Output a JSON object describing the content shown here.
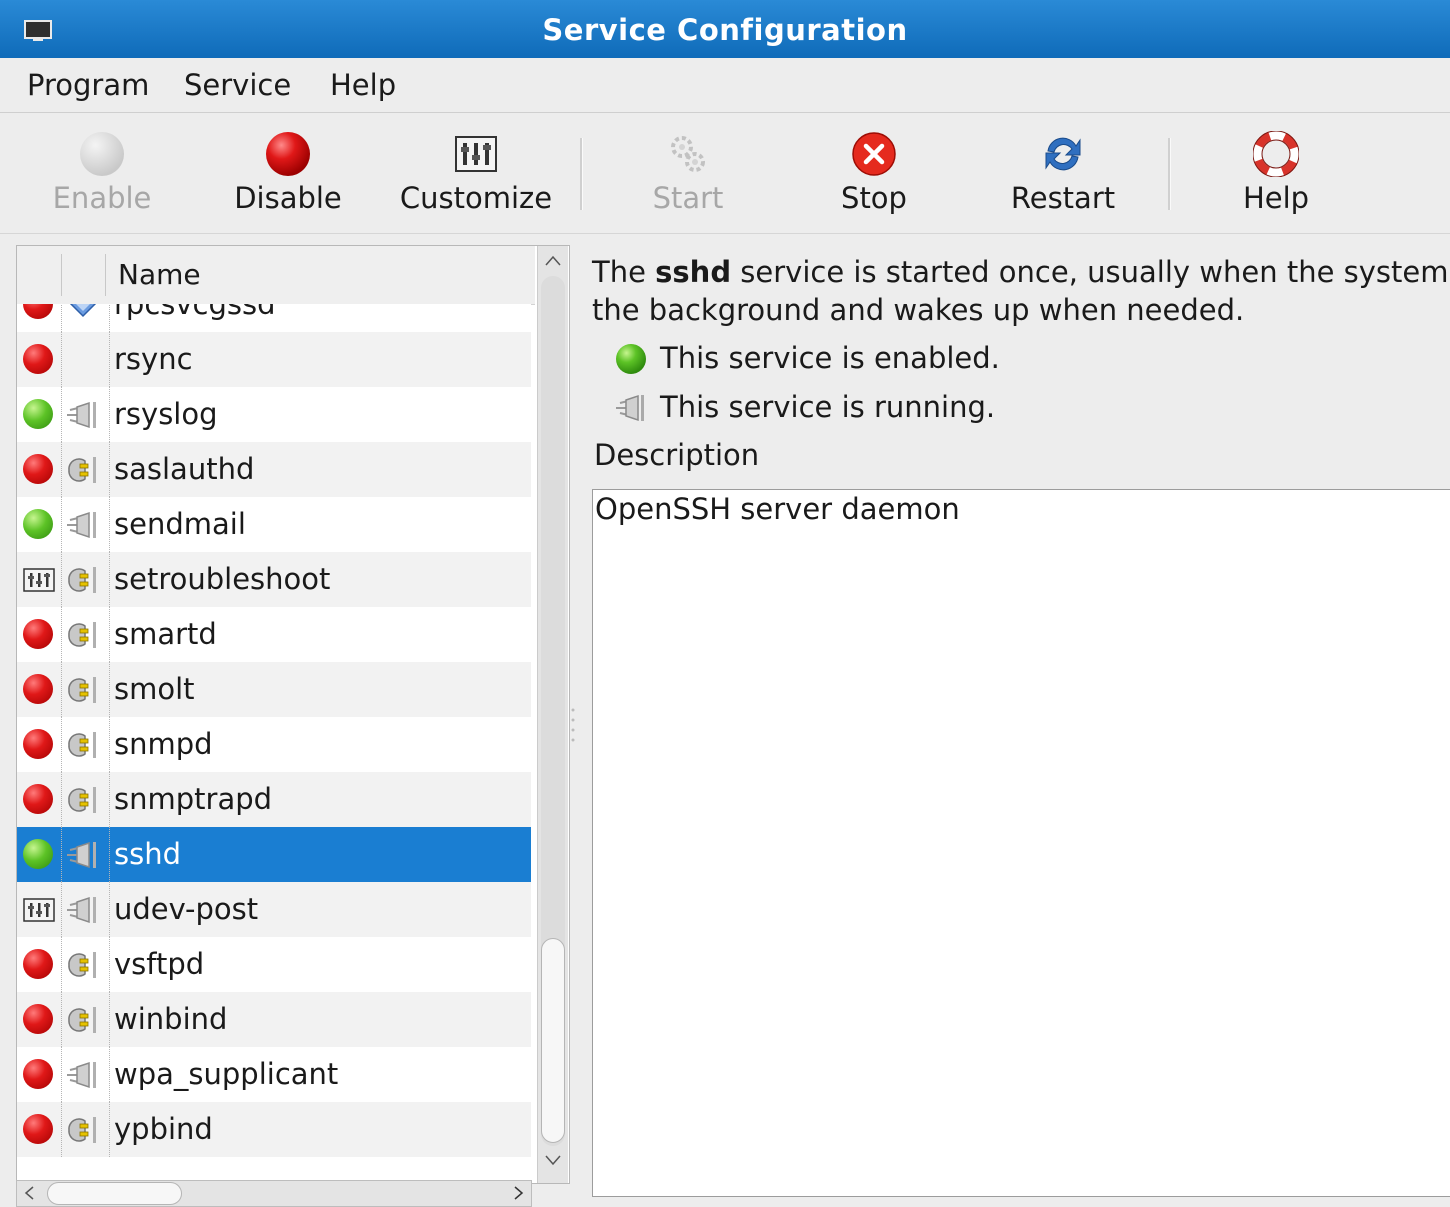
{
  "window": {
    "title": "Service Configuration"
  },
  "menu": {
    "program": "Program",
    "service": "Service",
    "help": "Help"
  },
  "toolbar": {
    "enable": "Enable",
    "disable": "Disable",
    "customize": "Customize",
    "start": "Start",
    "stop": "Stop",
    "restart": "Restart",
    "help": "Help"
  },
  "list": {
    "column_name": "Name",
    "rows": [
      {
        "name": "rpcsvcgssd",
        "state": "red",
        "type": "diamond"
      },
      {
        "name": "rsync",
        "state": "red",
        "type": "none"
      },
      {
        "name": "rsyslog",
        "state": "green",
        "type": "running-plug"
      },
      {
        "name": "saslauthd",
        "state": "red",
        "type": "stopped-plug"
      },
      {
        "name": "sendmail",
        "state": "green",
        "type": "running-plug"
      },
      {
        "name": "setroubleshoot",
        "state": "custom",
        "type": "stopped-plug"
      },
      {
        "name": "smartd",
        "state": "red",
        "type": "stopped-plug"
      },
      {
        "name": "smolt",
        "state": "red",
        "type": "stopped-plug"
      },
      {
        "name": "snmpd",
        "state": "red",
        "type": "stopped-plug"
      },
      {
        "name": "snmptrapd",
        "state": "red",
        "type": "stopped-plug"
      },
      {
        "name": "sshd",
        "state": "green",
        "type": "running-plug",
        "selected": true
      },
      {
        "name": "udev-post",
        "state": "custom",
        "type": "running-plug"
      },
      {
        "name": "vsftpd",
        "state": "red",
        "type": "stopped-plug"
      },
      {
        "name": "winbind",
        "state": "red",
        "type": "stopped-plug"
      },
      {
        "name": "wpa_supplicant",
        "state": "red",
        "type": "running-plug"
      },
      {
        "name": "ypbind",
        "state": "red",
        "type": "stopped-plug"
      }
    ]
  },
  "details": {
    "intro_prefix": "The ",
    "service_name": "sshd",
    "intro_suffix": " service is started once, usually when the system",
    "intro_line2": "the background and wakes up when needed.",
    "enabled_text": "This service is enabled.",
    "running_text": "This service is running.",
    "description_label": "Description",
    "description_text": "OpenSSH server daemon"
  },
  "colors": {
    "selection": "#1a7ed2",
    "titlebar": "#1a7ac6"
  }
}
